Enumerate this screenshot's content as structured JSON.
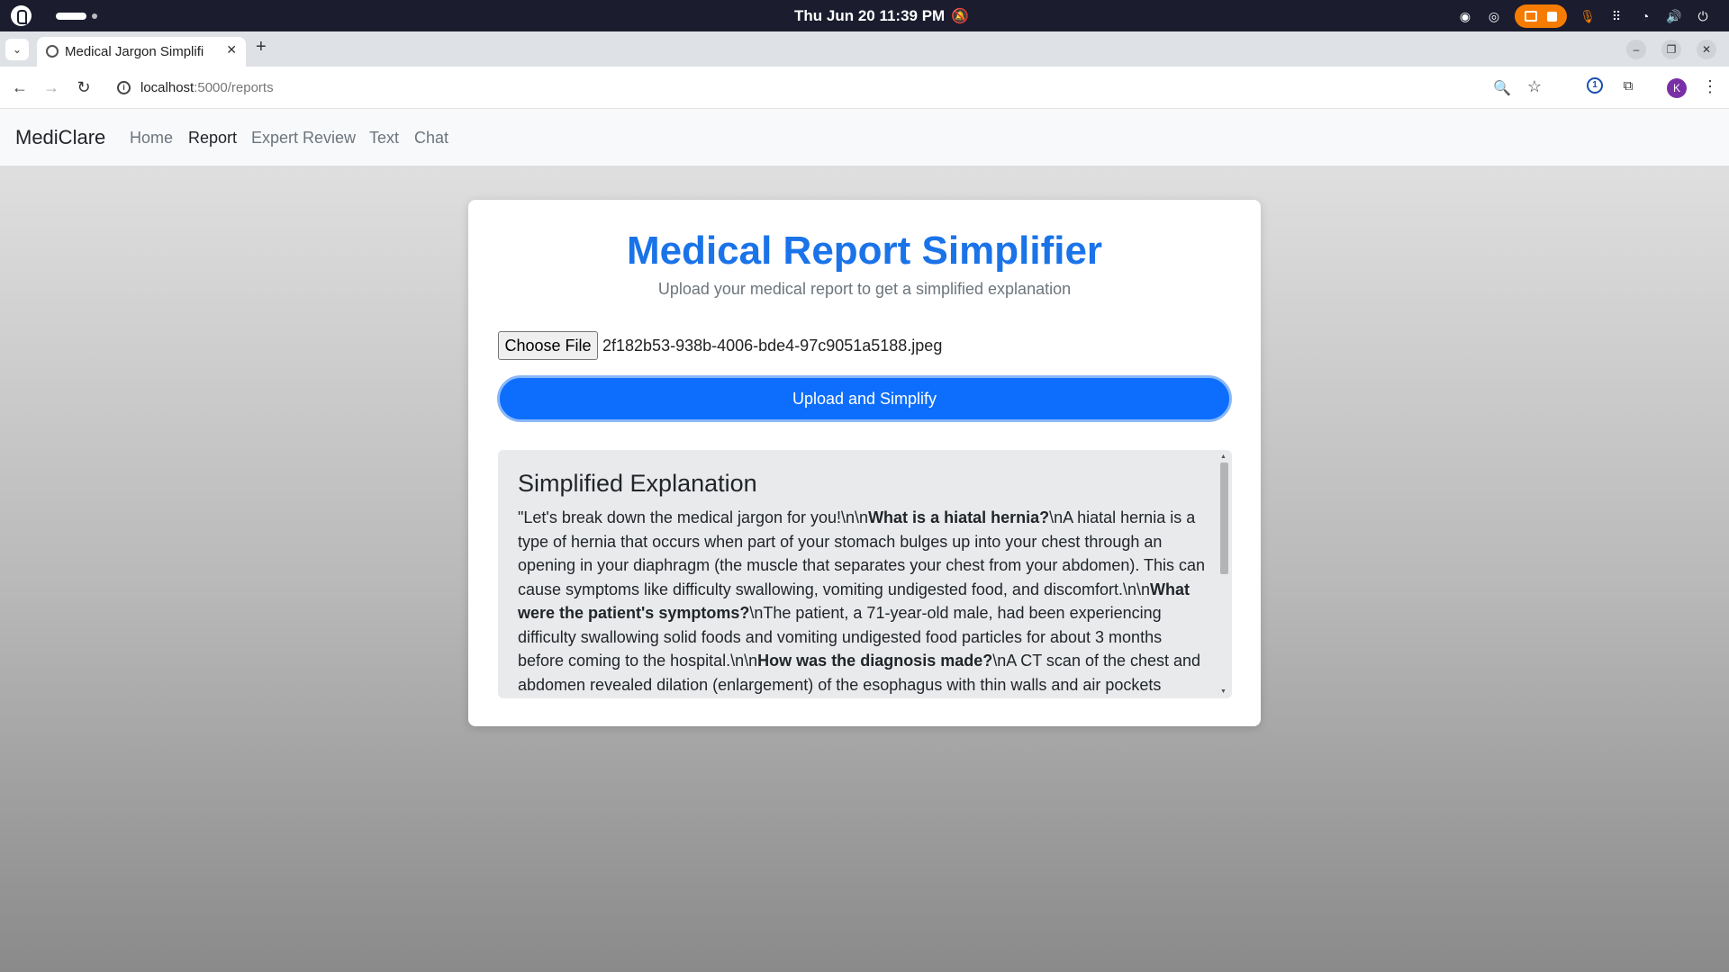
{
  "os_bar": {
    "clock": "Thu Jun 20  11:39 PM"
  },
  "browser": {
    "tab_title": "Medical Jargon Simplifi",
    "url_host": "localhost",
    "url_path": ":5000/reports",
    "avatar_initial": "K"
  },
  "navbar": {
    "brand": "MediClare",
    "links": [
      "Home",
      "Report",
      "Expert Review",
      "Text",
      "Chat"
    ],
    "active": "Report"
  },
  "card": {
    "title": "Medical Report Simplifier",
    "subtitle": "Upload your medical report to get a simplified explanation",
    "choose_file_label": "Choose File",
    "file_name": "2f182b53-938b-4006-bde4-97c9051a5188.jpeg",
    "upload_button": "Upload and Simplify",
    "result_heading": "Simplified Explanation",
    "result_segments": [
      {
        "text": "\"Let's break down the medical jargon for you!\\n\\n",
        "bold": false
      },
      {
        "text": "What is a hiatal hernia?",
        "bold": true
      },
      {
        "text": "\\nA hiatal hernia is a type of hernia that occurs when part of your stomach bulges up into your chest through an opening in your diaphragm (the muscle that separates your chest from your abdomen). This can cause symptoms like difficulty swallowing, vomiting undigested food, and discomfort.\\n\\n",
        "bold": false
      },
      {
        "text": "What were the patient's symptoms?",
        "bold": true
      },
      {
        "text": "\\nThe patient, a 71-year-old male, had been experiencing difficulty swallowing solid foods and vomiting undigested food particles for about 3 months before coming to the hospital.\\n\\n",
        "bold": false
      },
      {
        "text": "How was the diagnosis made?",
        "bold": true
      },
      {
        "text": "\\nA CT scan of the chest and abdomen revealed dilation (enlargement) of the esophagus with thin walls and air pockets inside.",
        "bold": false
      }
    ]
  },
  "colors": {
    "title_blue": "#1a73e8",
    "button_blue": "#0d6efd",
    "record_orange": "#f57c00"
  }
}
